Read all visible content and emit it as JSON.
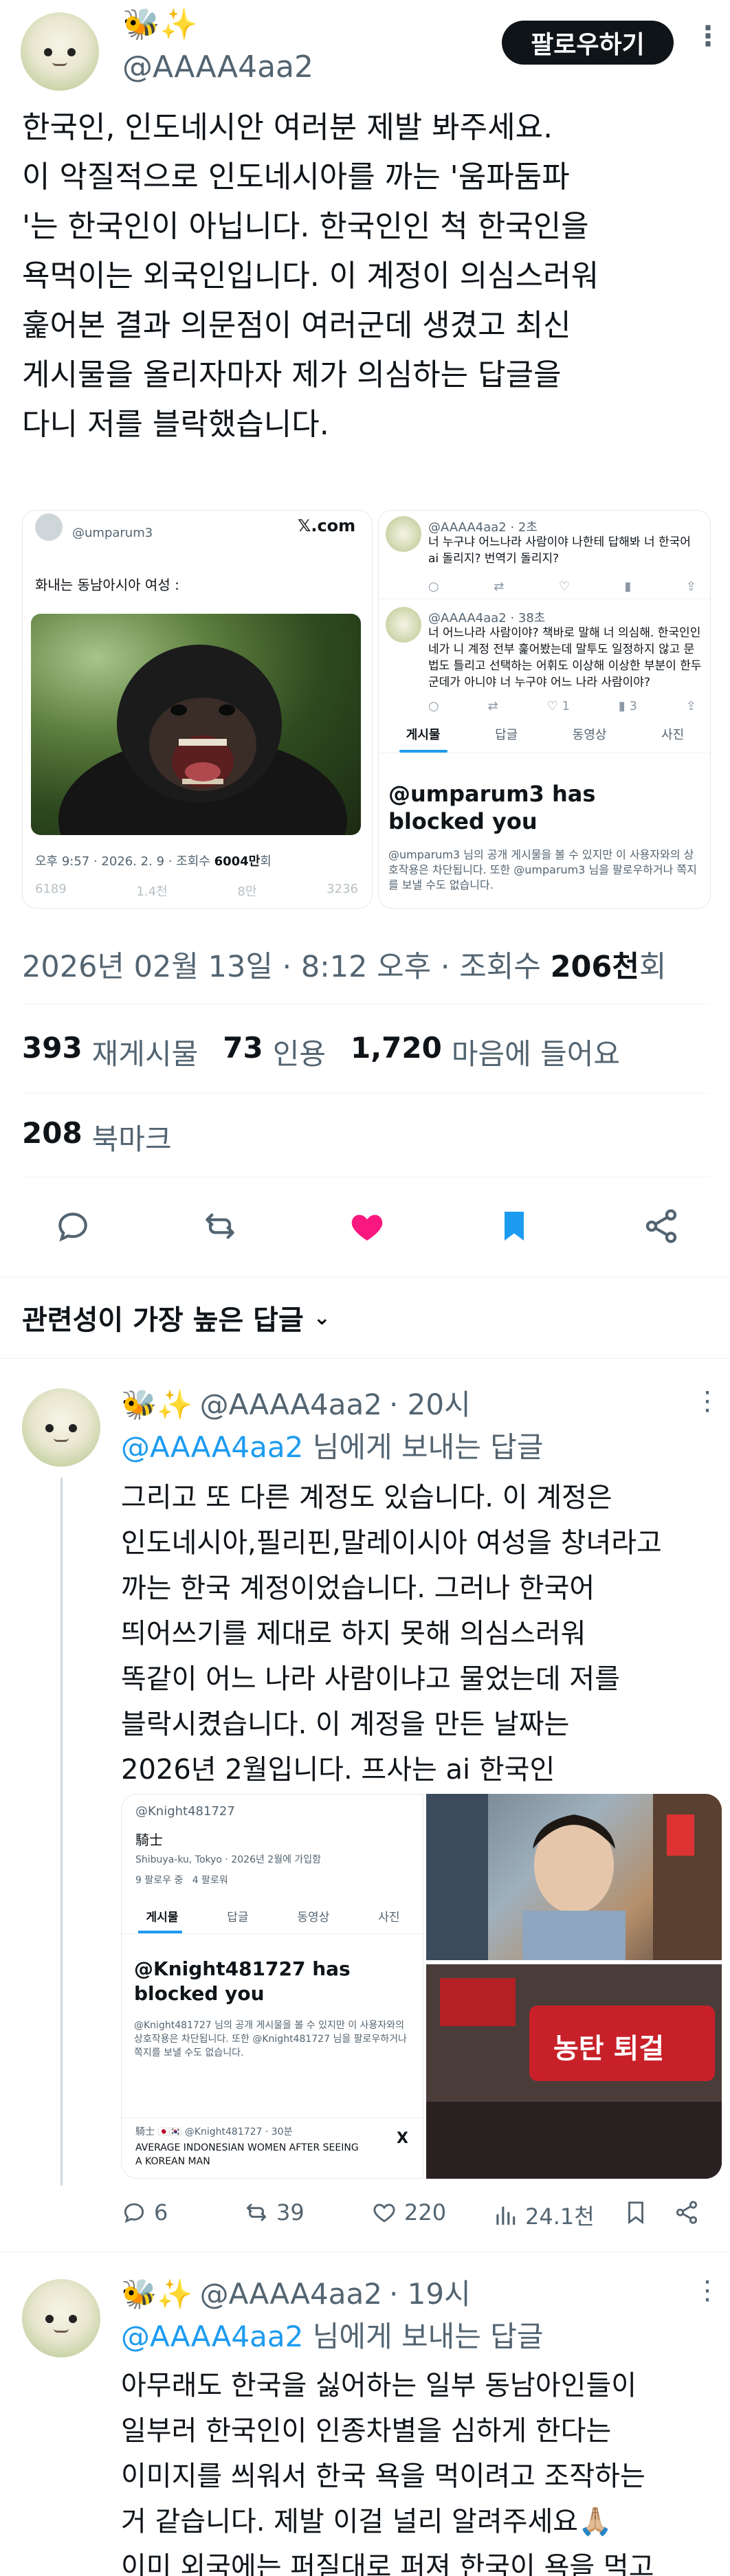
{
  "post": {
    "display_name_emoji": "🐝✨",
    "handle": "@AAAA4aa2",
    "follow_label": "팔로우하기",
    "more_label": "⋮",
    "text": "한국인, 인도네시안 여러분 제발 봐주세요.\n이 악질적으로 인도네시아를 까는 '움파둠파\n'는 한국인이 아닙니다. 한국인인 척 한국인을\n욕먹이는 외국인입니다. 이 계정이 의심스러워\n훑어본 결과 의문점이 여러군데 생겼고 최신\n게시물을 올리자마자 제가 의심하는 답글을\n다니 저를 블락했습니다.",
    "timestamp": "2026년 02월 13일 · 8:12 오후 · 조회수 ",
    "views": "206천",
    "views_suffix": "회",
    "stats": {
      "reposts_num": "393",
      "reposts_label": "재게시물",
      "quotes_num": "73",
      "quotes_label": "인용",
      "likes_num": "1,720",
      "likes_label": "마음에 들어요",
      "bookmarks_num": "208",
      "bookmarks_label": "북마크"
    }
  },
  "embedded_left": {
    "handle": "@umparum3",
    "logo": "𝕏.com",
    "caption": "화내는 동남아시아 여성 :",
    "footer_time": "오후 9:57 · 2026. 2. 9 · 조회수 ",
    "footer_views": "6004만",
    "footer_suffix": "회",
    "action_counts": [
      "6189",
      "1.4천",
      "8만",
      "3236"
    ]
  },
  "embedded_right": {
    "reply1_handle": "@AAAA4aa2 · 2초",
    "reply1_text": "너 누구냐 어느나라 사람이야 나한테 답해봐 너 한국어 ai 돌리지? 번역기 돌리지?",
    "reply2_handle": "@AAAA4aa2 · 38초",
    "reply2_text": "너 어느나라 사람이야? 책바로 말해 너 의심해. 한국인인 네가 니 계정 전부 훑어봤는데 말투도 일정하지 않고 문법도 틀리고 선택하는 어휘도 이상해 이상한 부분이 한두 군데가 아니야 너 누구야 어느 나라 사람이야?",
    "reply2_counts": [
      "",
      "",
      "1",
      "3",
      ""
    ],
    "tabs": [
      "게시물",
      "답글",
      "동영상",
      "사진"
    ],
    "blocked_title": "@umparum3 has blocked you",
    "blocked_body": "@umparum3 님의 공개 게시물을 볼 수 있지만 이 사용자와의 상호작용은 차단됩니다. 또한 @umparum3 님을 팔로우하거나 쪽지를 보낼 수도 없습니다."
  },
  "section_title": "관련성이 가장 높은 답글",
  "reply1": {
    "emoji": "🐝✨",
    "handle": "@AAAA4aa2",
    "time": "· 20시",
    "to_handle": "@AAAA4aa2",
    "to_suffix": "님에게 보내는 답글",
    "text": "그리고 또 다른 계정도 있습니다. 이 계정은\n인도네시아,필리핀,말레이시아 여성을 창녀라고\n까는 한국 계정이었습니다. 그러나 한국어\n띄어쓰기를 제대로 하지 못해 의심스러워\n똑같이 어느 나라 사람이냐고 물었는데 저를\n블락시켰습니다. 이 계정을 만든 날짜는\n2026년 2월입니다. 프사는 ai 한국인",
    "embedded": {
      "handle": "@Knight481727",
      "name": "騎士",
      "location": "Shibuya-ku, Tokyo",
      "joined": "2026년 2월에 가입함",
      "following": "9 팔로우 중",
      "followers": "4 팔로워",
      "tabs": [
        "게시물",
        "답글",
        "동영상",
        "사진"
      ],
      "blocked_title": "@Knight481727 has blocked you",
      "blocked_body": "@Knight481727 님의 공개 게시물을 볼 수 있지만 이 사용자와의 상호작용은 차단됩니다. 또한 @Knight481727 님을 팔로우하거나 쪽지를 보낼 수도 없습니다.",
      "tweet_header": "騎士 🇯🇵🇰🇷 @Knight481727 · 30분",
      "tweet_text": "AVERAGE INDONESIAN WOMEN AFTER SEEING A KOREAN MAN",
      "sign_text": "농탄 퇴걸"
    },
    "counts": {
      "replies": "6",
      "reposts": "39",
      "likes": "220",
      "views": "24.1천"
    }
  },
  "reply2": {
    "emoji": "🐝✨",
    "handle": "@AAAA4aa2",
    "time": "· 19시",
    "to_handle": "@AAAA4aa2",
    "to_suffix": "님에게 보내는 답글",
    "text": "아무래도 한국을 싫어하는 일부 동남아인들이\n일부러 한국인이 인종차별을 심하게 한다는\n이미지를 씌워서 한국 욕을 먹이려고 조작하는\n거 같습니다. 제발 이걸 널리 알려주세요🙏🏼\n이미 외국에는 퍼질대로 퍼져 한국이 욕을 먹고\n있는 상황입니다😭"
  },
  "colors": {
    "accent": "#1d9bf0",
    "like": "#f91880",
    "bookmark": "#1d9bf0",
    "text": "#0f1419",
    "muted": "#536471"
  }
}
